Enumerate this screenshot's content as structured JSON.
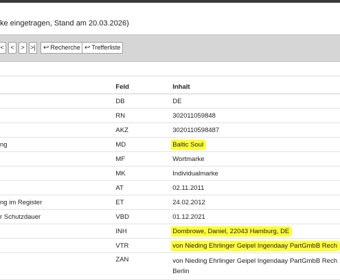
{
  "status_line": "ke eingetragen, Stand am 20.03.2026)",
  "toolbar": {
    "nav": [
      "<",
      "<",
      ">",
      ">|"
    ],
    "recherche_label": "Recherche",
    "trefferliste_label": "Trefferliste",
    "return_icon": "↩"
  },
  "table": {
    "headers": [
      "",
      "Feld",
      "Inhalt"
    ],
    "rows": [
      {
        "label": "",
        "feld": "DB",
        "inhalt": "DE"
      },
      {
        "label": "",
        "feld": "RN",
        "inhalt": "302011059848"
      },
      {
        "label": "",
        "feld": "AKZ",
        "inhalt": "3020110598487"
      },
      {
        "label": "ng",
        "feld": "MD",
        "inhalt": "Baltic Soul"
      },
      {
        "label": "",
        "feld": "MF",
        "inhalt": "Wortmarke"
      },
      {
        "label": "",
        "feld": "MK",
        "inhalt": "Individualmarke"
      },
      {
        "label": "",
        "feld": "AT",
        "inhalt": "02.11.2011"
      },
      {
        "label": "ng im Register",
        "feld": "ET",
        "inhalt": "24.02.2012"
      },
      {
        "label": "r Schutzdauer",
        "feld": "VBD",
        "inhalt": "01.12.2021"
      },
      {
        "label": "",
        "feld": "INH",
        "inhalt": "Dombrowe, Daniel, 22043 Hamburg, DE"
      },
      {
        "label": "",
        "feld": "VTR",
        "inhalt": "von Nieding Ehrlinger Geipel Ingendaay PartGmbB Rech"
      },
      {
        "label": "",
        "feld": "ZAN",
        "inhalt": "von Nieding Ehrlinger Geipel Ingendaay PartGmbB Rech Berlin"
      }
    ]
  },
  "colors": {
    "highlight": "#ffff3a",
    "toolbar_bg": "#d6d6d6"
  }
}
